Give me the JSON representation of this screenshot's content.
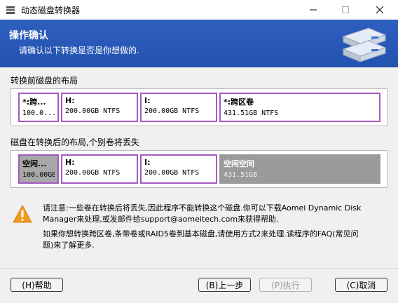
{
  "window": {
    "title": "动态磁盘转换器"
  },
  "banner": {
    "title": "操作确认",
    "subtitle": "请确认以下转换是否是你想做的.",
    "art_icon": "disk-drives-icon"
  },
  "before": {
    "label": "转换前磁盘的布局",
    "partitions": [
      {
        "name": "*:跨...",
        "size": "100.0..."
      },
      {
        "name": "H:",
        "size": "200.00GB NTFS"
      },
      {
        "name": "I:",
        "size": "200.00GB NTFS"
      },
      {
        "name": "*:跨区卷",
        "size": "431.51GB NTFS"
      }
    ]
  },
  "after": {
    "label": "磁盘在转换后的布局,个别卷将丢失",
    "partitions": [
      {
        "name": "空闲...",
        "size": "100.00GB"
      },
      {
        "name": "H:",
        "size": "200.00GB NTFS"
      },
      {
        "name": "I:",
        "size": "200.00GB NTFS"
      },
      {
        "name": "空闲空间",
        "size": "431.51GB"
      }
    ]
  },
  "notes": {
    "warning_line1": "请注意:一些卷在转换后将丢失,因此程序不能转换这个磁盘.你可以下载Aomei Dynamic Disk",
    "warning_line2": "Manager来处理,或发邮件给support@aomeitech.com来获得帮助.",
    "info_line1": "如果你想转换跨区卷,条带卷或RAID5卷到基本磁盘,请使用方式2来处理.读程序的FAQ(常见问",
    "info_line2": "题)来了解更多."
  },
  "buttons": {
    "help": "(H)帮助",
    "back": "(B)上一步",
    "execute": "(P)执行",
    "cancel": "(C)取消"
  },
  "colors": {
    "banner": "#2e5fbf",
    "partition_border": "#a45bbf",
    "free_space": "#9a9a9a"
  }
}
